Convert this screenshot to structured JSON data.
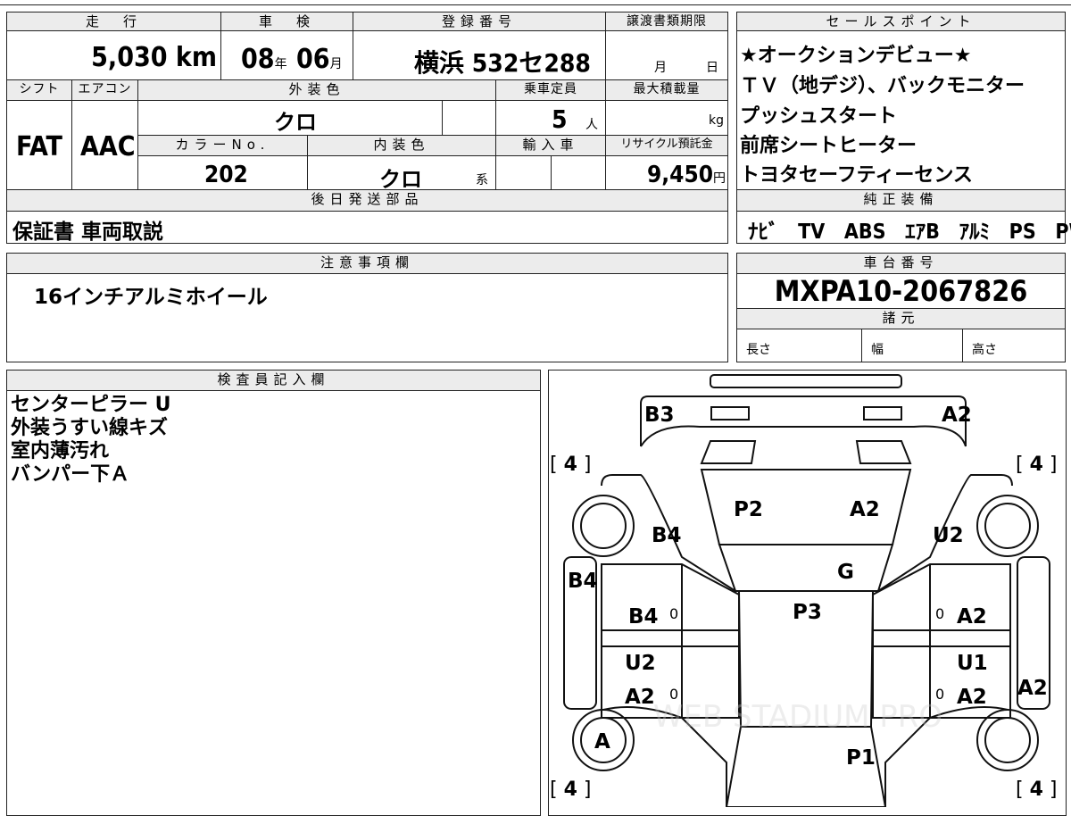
{
  "top": {
    "mileage_hdr": "走　行",
    "mileage_val": "5,030",
    "mileage_unit": "km",
    "inspection_hdr": "車　検",
    "insp_year": "08",
    "insp_year_unit": "年",
    "insp_month": "06",
    "insp_month_unit": "月",
    "reg_hdr": "登録番号",
    "reg_val": "横浜 532セ288",
    "transfer_hdr": "譲渡書類期限",
    "transfer_month": "月",
    "transfer_day": "日",
    "shift_hdr": "シフト",
    "shift_val": "FAT",
    "ac_hdr": "エアコン",
    "ac_val": "AAC",
    "ext_color_hdr": "外装色",
    "ext_color_val": "クロ",
    "capacity_hdr": "乗車定員",
    "capacity_val": "5",
    "capacity_unit": "人",
    "maxload_hdr": "最大積載量",
    "maxload_unit": "kg",
    "colorno_hdr": "カラーNo.",
    "colorno_val": "202",
    "int_color_hdr": "内装色",
    "int_color_val": "クロ",
    "int_color_unit": "系",
    "import_hdr": "輸入車",
    "recycle_hdr": "リサイクル預託金",
    "recycle_val": "9,450",
    "recycle_unit": "円",
    "later_hdr": "後日発送部品",
    "later_val": "保証書 車両取説"
  },
  "sales": {
    "hdr": "セールスポイント",
    "lines": [
      "★オークションデビュー★",
      "ＴＶ（地デジ）、バックモニター",
      "プッシュスタート",
      "前席シートヒーター",
      "トヨタセーフティーセンス"
    ]
  },
  "equipment": {
    "hdr": "純正装備",
    "items": [
      "ﾅﾋﾞ",
      "TV",
      "ABS",
      "ｴｱB",
      "ｱﾙﾐ",
      "PS",
      "PW"
    ]
  },
  "notes": {
    "hdr": "注意事項欄",
    "val": "16インチアルミホイール"
  },
  "chassis": {
    "hdr": "車台番号",
    "val": "MXPA10-2067826"
  },
  "specs": {
    "hdr": "諸元",
    "length": "長さ",
    "width": "幅",
    "height": "高さ"
  },
  "inspector": {
    "hdr": "検査員記入欄",
    "lines": [
      "センターピラー U",
      "外装うすい線キズ",
      "室内薄汚れ",
      "バンパー下Ａ"
    ]
  },
  "diagram": {
    "marks": {
      "B3": "B3",
      "A2_tr": "A2",
      "P2": "P2",
      "A2_hood": "A2",
      "B4_fl": "B4",
      "U2_fr": "U2",
      "G": "G",
      "B4_side": "B4",
      "P3": "P3",
      "B4_ld": "B4",
      "A2_rd": "A2",
      "U2_lr": "U2",
      "U1": "U1",
      "A2_lr": "A2",
      "A2_rr": "A2",
      "A2_side": "A2",
      "A": "A",
      "P1": "P1"
    },
    "tire_depth": "4",
    "zero": "0",
    "watermark": "WEB STADIUM PRO"
  }
}
